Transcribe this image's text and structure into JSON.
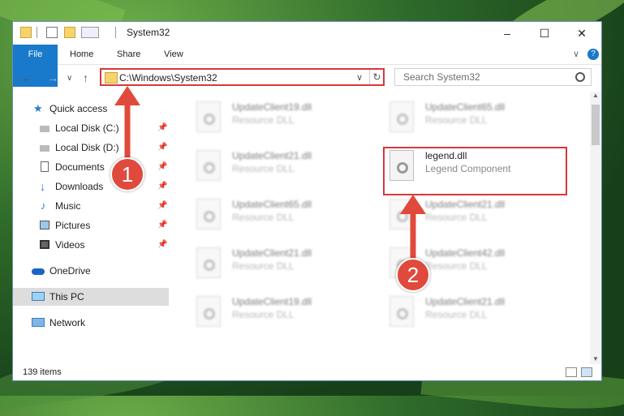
{
  "window": {
    "title": "System32",
    "controls": {
      "minimize": "–",
      "maximize": "☐",
      "close": "✕"
    }
  },
  "ribbon": {
    "tabs": [
      "File",
      "Home",
      "Share",
      "View"
    ],
    "expand": "∨",
    "help": "?"
  },
  "nav": {
    "back": "←",
    "forward": "→",
    "recent": "∨",
    "up": "↑",
    "address": "C:\\Windows\\System32",
    "address_dropdown": "∨",
    "refresh": "↻",
    "search_placeholder": "Search System32"
  },
  "sidebar": {
    "items": [
      {
        "label": "Quick access",
        "pinned": false,
        "icon": "star-icon"
      },
      {
        "label": "Local Disk (C:)",
        "pinned": true,
        "icon": "drive-icon"
      },
      {
        "label": "Local Disk (D:)",
        "pinned": true,
        "icon": "drive-icon"
      },
      {
        "label": "Documents",
        "pinned": true,
        "icon": "document-icon"
      },
      {
        "label": "Downloads",
        "pinned": true,
        "icon": "download-icon"
      },
      {
        "label": "Music",
        "pinned": true,
        "icon": "music-icon"
      },
      {
        "label": "Pictures",
        "pinned": true,
        "icon": "picture-icon"
      },
      {
        "label": "Videos",
        "pinned": true,
        "icon": "video-icon"
      },
      {
        "label": "OneDrive",
        "pinned": false,
        "icon": "cloud-icon"
      },
      {
        "label": "This PC",
        "pinned": false,
        "icon": "computer-icon",
        "selected": true
      },
      {
        "label": "Network",
        "pinned": false,
        "icon": "network-icon"
      }
    ],
    "pin_glyph": "📌"
  },
  "files": {
    "left": [
      {
        "name": "UpdateClient19.dll",
        "desc": "Resource DLL"
      },
      {
        "name": "UpdateClient21.dll",
        "desc": "Resource DLL"
      },
      {
        "name": "UpdateClient65.dll",
        "desc": "Resource DLL"
      },
      {
        "name": "UpdateClient21.dll",
        "desc": "Resource DLL"
      },
      {
        "name": "UpdateClient19.dll",
        "desc": "Resource DLL"
      }
    ],
    "right": [
      {
        "name": "UpdateClient65.dll",
        "desc": "Resource DLL"
      },
      {
        "name": "legend.dll",
        "desc": "Legend Component"
      },
      {
        "name": "UpdateClient21.dll",
        "desc": "Resource DLL"
      },
      {
        "name": "UpdateClient42.dll",
        "desc": "Resource DLL"
      },
      {
        "name": "UpdateClient21.dll",
        "desc": "Resource DLL"
      }
    ]
  },
  "status": {
    "count": "139 items"
  },
  "callouts": {
    "one": "1",
    "two": "2"
  },
  "colors": {
    "accent": "#1979ca",
    "highlight": "#d9383a",
    "callout": "#e04a3c"
  }
}
